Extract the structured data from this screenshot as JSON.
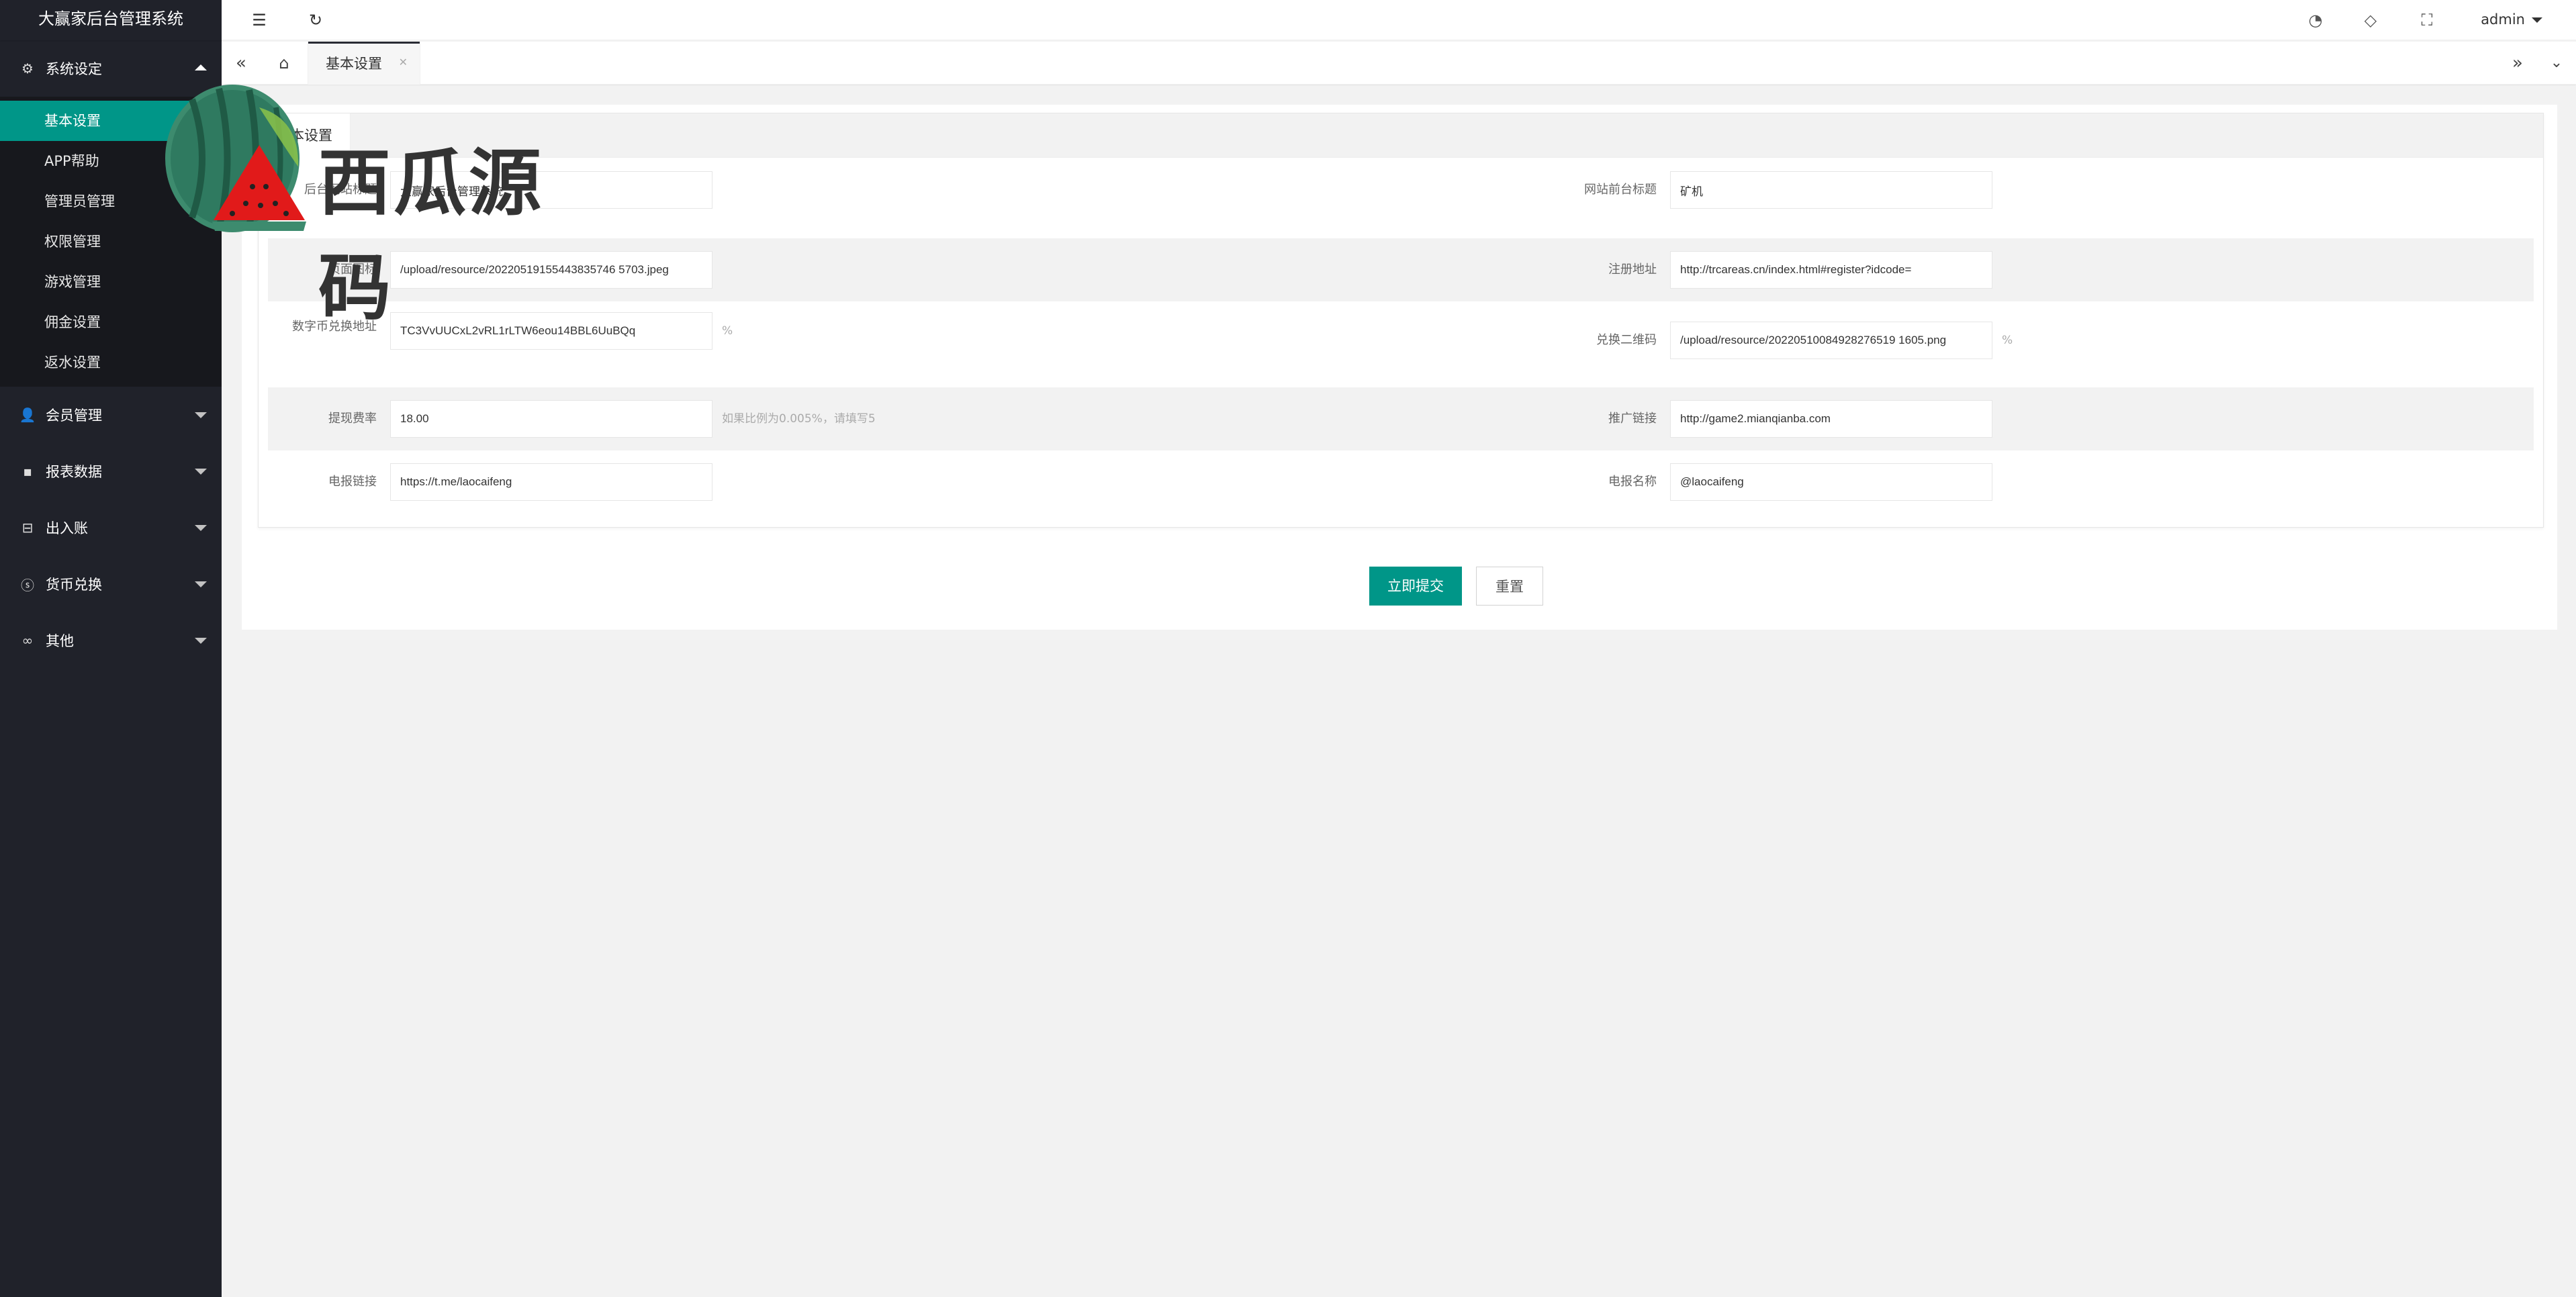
{
  "app": {
    "title": "大赢家后台管理系统"
  },
  "sidebar": {
    "groups": [
      {
        "label": "系统设定",
        "icon": "gear-icon",
        "expanded": true,
        "items": [
          {
            "label": "基本设置",
            "active": true
          },
          {
            "label": "APP帮助"
          },
          {
            "label": "管理员管理"
          },
          {
            "label": "权限管理"
          },
          {
            "label": "游戏管理"
          },
          {
            "label": "佣金设置"
          },
          {
            "label": "返水设置"
          }
        ]
      },
      {
        "label": "会员管理",
        "icon": "user-icon"
      },
      {
        "label": "报表数据",
        "icon": "chat-icon"
      },
      {
        "label": "出入账",
        "icon": "car-icon"
      },
      {
        "label": "货币兑换",
        "icon": "dollar-icon"
      },
      {
        "label": "其他",
        "icon": "link-icon"
      }
    ]
  },
  "header": {
    "user": "admin"
  },
  "tabs": {
    "active": "基本设置"
  },
  "form": {
    "section_title": "基本设置",
    "fields": {
      "backend_title": {
        "label": "后台网站标题",
        "value": "大赢家后台管理系统"
      },
      "site_title": {
        "label": "网站前台标题",
        "value": "矿机"
      },
      "page_icon": {
        "label": "页面图标",
        "value": "/upload/resource/20220519155443835746 5703.jpeg"
      },
      "register_url": {
        "label": "注册地址",
        "value": "http://trcareas.cn/index.html#register?idcode="
      },
      "coin_address": {
        "label": "数字币兑换地址",
        "value": "TC3VvUUCxL2vRL1rLTW6eou14BBL6UuBQq",
        "suffix": "%"
      },
      "exchange_qr": {
        "label": "兑换二维码",
        "value": "/upload/resource/20220510084928276519 1605.png",
        "suffix": "%"
      },
      "withdraw_rate": {
        "label": "提现费率",
        "value": "18.00",
        "hint": "如果比例为0.005%，请填写5"
      },
      "promo_link": {
        "label": "推广链接",
        "value": "http://game2.mianqianba.com"
      },
      "telegram_link": {
        "label": "电报链接",
        "value": "https://t.me/laocaifeng"
      },
      "telegram_name": {
        "label": "电报名称",
        "value": "@laocaifeng"
      }
    },
    "submit_label": "立即提交",
    "reset_label": "重置"
  },
  "watermark": {
    "text": "西瓜源码"
  },
  "colors": {
    "sidebar": "#20222a",
    "accent": "#009688",
    "submenu": "#17181d"
  }
}
